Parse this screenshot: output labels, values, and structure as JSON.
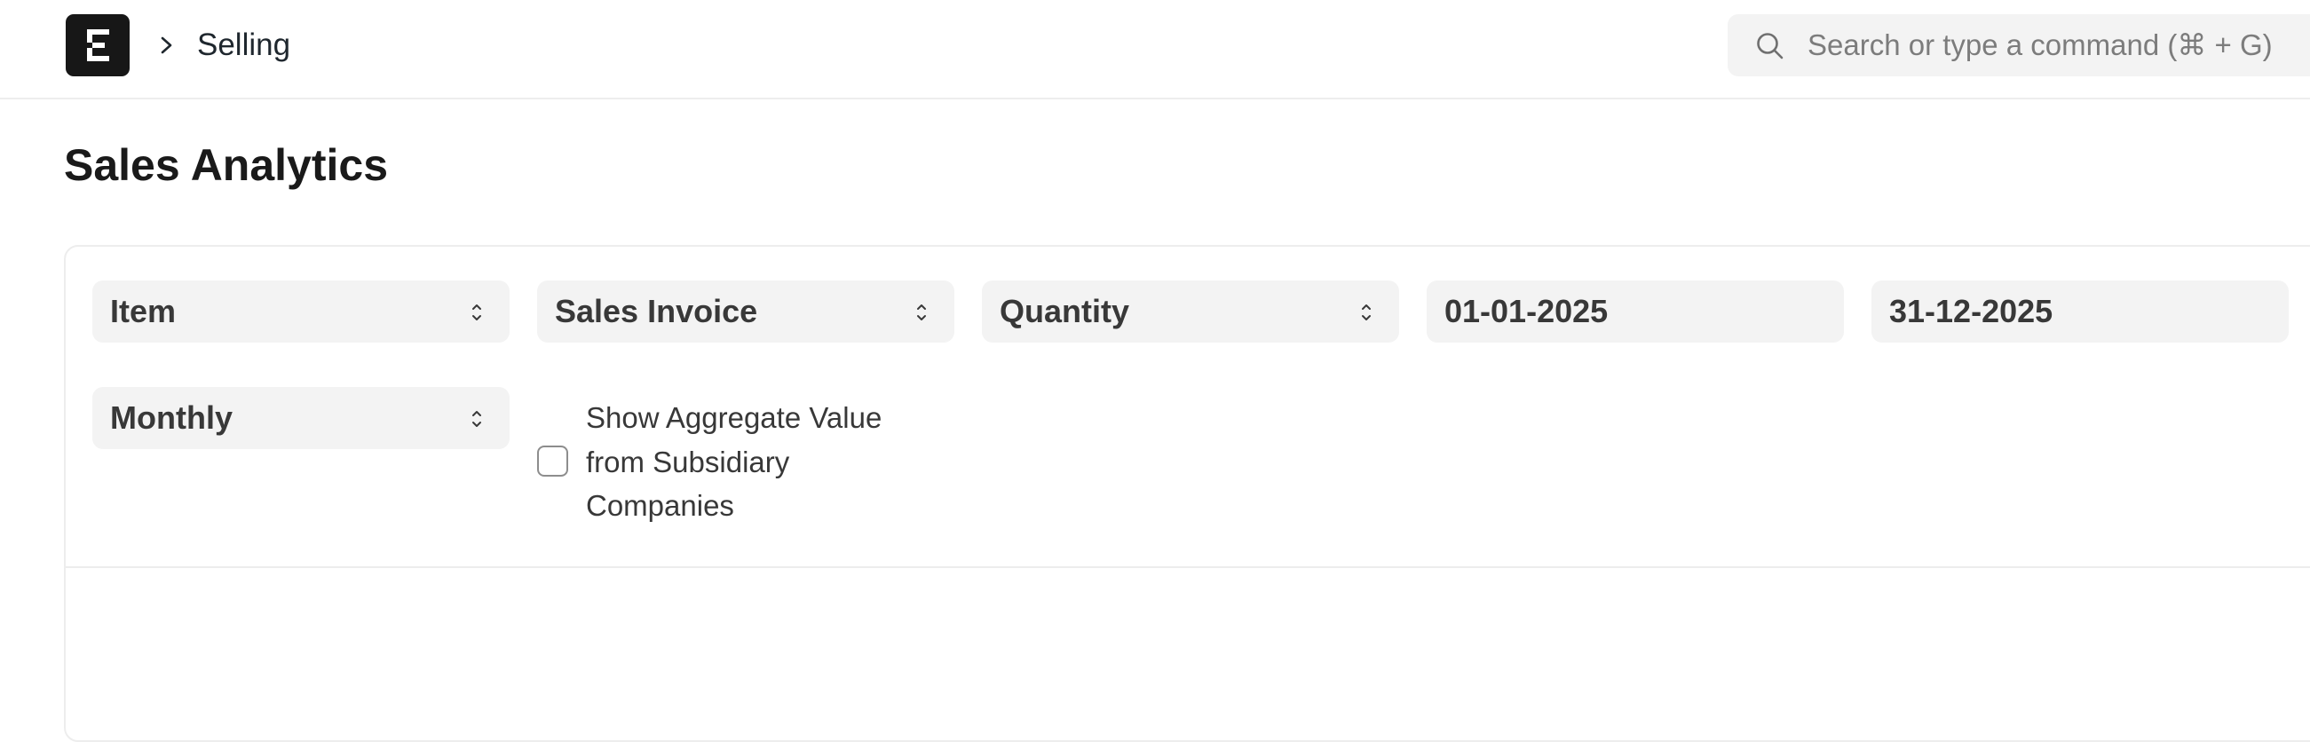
{
  "navbar": {
    "logo_letter": "E",
    "breadcrumb": "Selling",
    "search_placeholder": "Search or type a command (⌘ + G)"
  },
  "page": {
    "title": "Sales Analytics"
  },
  "filters": {
    "tree_type": "Item",
    "doc_type": "Sales Invoice",
    "value_quantity": "Quantity",
    "from_date": "01-01-2025",
    "to_date": "31-12-2025",
    "range": "Monthly",
    "show_aggregate_label": "Show Aggregate Value from Subsidiary Companies",
    "show_aggregate_checked": false
  },
  "icons": {
    "logo": "erpnext-logo-icon",
    "breadcrumb_separator": "chevron-right-icon",
    "search": "search-icon",
    "select": "select-arrows-icon"
  },
  "colors": {
    "logo_bg": "#171717",
    "control_bg": "#f3f3f3",
    "border": "#ededed",
    "text": "#383838",
    "placeholder": "#7c7c7c"
  }
}
